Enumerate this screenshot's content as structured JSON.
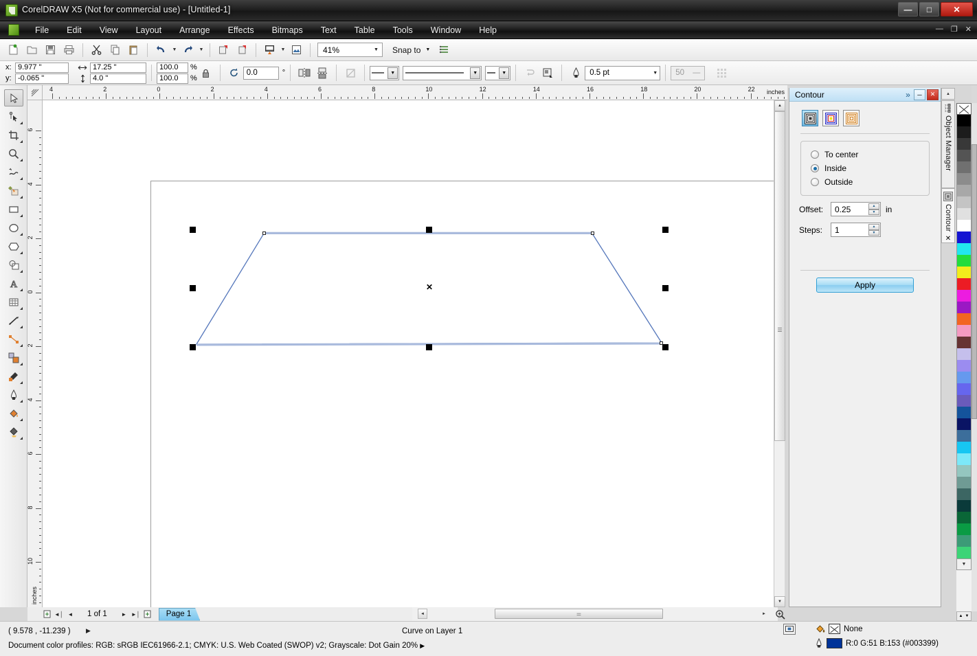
{
  "window": {
    "title": "CorelDRAW X5 (Not for commercial use) - [Untitled-1]",
    "app_icon": "coreldraw-icon",
    "buttons": {
      "minimize": "—",
      "maximize": "❐",
      "close": "✕"
    }
  },
  "menubar": {
    "doc_icon": "document-icon",
    "items": [
      {
        "label": "File",
        "mnemonic": "F"
      },
      {
        "label": "Edit",
        "mnemonic": "E"
      },
      {
        "label": "View",
        "mnemonic": "V"
      },
      {
        "label": "Layout",
        "mnemonic": "L"
      },
      {
        "label": "Arrange",
        "mnemonic": "A"
      },
      {
        "label": "Effects",
        "mnemonic": "c"
      },
      {
        "label": "Bitmaps",
        "mnemonic": "B"
      },
      {
        "label": "Text",
        "mnemonic": "x"
      },
      {
        "label": "Table",
        "mnemonic": "T"
      },
      {
        "label": "Tools",
        "mnemonic": "o"
      },
      {
        "label": "Window",
        "mnemonic": "W"
      },
      {
        "label": "Help",
        "mnemonic": "H"
      }
    ],
    "doc_buttons": {
      "minimize": "—",
      "restore": "❐",
      "close": "✕"
    }
  },
  "toolbar": {
    "buttons": [
      "new-icon",
      "open-icon",
      "save-icon",
      "print-icon",
      "cut-icon",
      "copy-icon",
      "paste-icon",
      "undo-icon",
      "redo-icon",
      "import-icon",
      "export-icon",
      "application-launcher-icon",
      "corel-connect-icon"
    ],
    "zoom_level": "41%",
    "snap_to_label": "Snap to",
    "options_icon": "options-icon"
  },
  "propertybar": {
    "x_label": "x:",
    "x_value": "9.977 \"",
    "y_label": "y:",
    "y_value": "-0.065 \"",
    "width_icon": "width-icon",
    "width_value": "17.25 \"",
    "height_icon": "height-icon",
    "height_value": "4.0 \"",
    "scale_h": "100.0",
    "scale_v": "100.0",
    "percent_symbol": "%",
    "lock_icon": "lock-ratio-icon",
    "rotate_icon": "rotation-icon",
    "rotation_value": "0.0",
    "degree_symbol": "°",
    "mirror_h_icon": "mirror-horizontal-icon",
    "mirror_v_icon": "mirror-vertical-icon",
    "to_curves_icon": "convert-to-curves-icon",
    "outline_arrow_label": "outline-arrow-selector",
    "outline_style_label": "outline-style-selector",
    "outline_end_arrow_label": "outline-end-arrow-selector",
    "wrap_text_icon": "wrap-paragraph-text-icon",
    "text_wrap_icon": "text-wrap-icon",
    "outline_pen_icon": "outline-width-icon",
    "outline_width": "0.5 pt",
    "bleed_value": "50",
    "bleed_icon": "bleed-limit-icon",
    "transparency_icon": "transparency-icon"
  },
  "toolbox": {
    "tools": [
      {
        "name": "pick-tool",
        "selected": true
      },
      {
        "name": "shape-tool",
        "selected": false
      },
      {
        "name": "crop-tool",
        "selected": false
      },
      {
        "name": "zoom-tool",
        "selected": false
      },
      {
        "name": "freehand-tool",
        "selected": false
      },
      {
        "name": "smart-fill-tool",
        "selected": false
      },
      {
        "name": "rectangle-tool",
        "selected": false
      },
      {
        "name": "ellipse-tool",
        "selected": false
      },
      {
        "name": "polygon-tool",
        "selected": false
      },
      {
        "name": "basic-shapes-tool",
        "selected": false
      },
      {
        "name": "text-tool",
        "selected": false
      },
      {
        "name": "table-tool",
        "selected": false
      },
      {
        "name": "dimension-tool",
        "selected": false
      },
      {
        "name": "connector-tool",
        "selected": false
      },
      {
        "name": "blend-tool",
        "selected": false
      },
      {
        "name": "transparency-tool",
        "selected": false
      },
      {
        "name": "color-eyedropper-tool",
        "selected": false
      },
      {
        "name": "outline-tool",
        "selected": false
      },
      {
        "name": "fill-tool",
        "selected": false
      },
      {
        "name": "interactive-fill-tool",
        "selected": false
      }
    ]
  },
  "rulers": {
    "unit_label": "inches",
    "h_ticks": [
      "4",
      "2",
      "0",
      "2",
      "4",
      "6",
      "8",
      "10",
      "12",
      "14",
      "16",
      "18",
      "20",
      "22"
    ],
    "v_ticks": [
      "6",
      "4",
      "2",
      "0",
      "2",
      "4",
      "6",
      "8",
      "10"
    ],
    "v_unit_label": "inches"
  },
  "canvas": {
    "selection_marker": "✕",
    "shape_name": "trapezoid-curve",
    "shape_outline_color": "#5577bb"
  },
  "pagebar": {
    "add_page_start_icon": "add-page-before-icon",
    "first_icon": "◀◀",
    "prev_icon": "◀",
    "page_counter": "1 of 1",
    "next_icon": "▶",
    "last_icon": "▶▶",
    "add_page_end_icon": "add-page-after-icon",
    "page_tab_label": "Page 1"
  },
  "statusbar": {
    "coordinates": "( 9.578 , -11.239 )",
    "expand_icon": "▶",
    "object_info": "Curve on Layer 1",
    "color_profiles": "Document color profiles: RGB: sRGB IEC61966-2.1; CMYK: U.S. Web Coated (SWOP) v2; Grayscale: Dot Gain 20%",
    "profiles_arrow": "▶",
    "fill_icon": "fill-bucket-icon",
    "fill_value": "None",
    "outline_icon": "outline-pen-icon",
    "outline_value": "R:0 G:51 B:153 (#003399)",
    "outline_color_hex": "#003399",
    "display_icon": "display-settings-icon"
  },
  "docker": {
    "title": "Contour",
    "expand_icon": "»",
    "minimize_icon": "—",
    "close_icon": "✕",
    "preset_buttons": [
      {
        "name": "contour-to-center-preset",
        "active": true
      },
      {
        "name": "contour-inside-preset",
        "active": false
      },
      {
        "name": "contour-outside-preset",
        "active": false
      }
    ],
    "direction_options": [
      {
        "label": "To center",
        "selected": false
      },
      {
        "label": "Inside",
        "selected": true
      },
      {
        "label": "Outside",
        "selected": false
      }
    ],
    "offset_label": "Offset:",
    "offset_value": "0.25",
    "offset_unit": "in",
    "steps_label": "Steps:",
    "steps_value": "1",
    "apply_label": "Apply",
    "side_tabs": [
      {
        "label": "Object Manager",
        "icon": "object-manager-icon"
      },
      {
        "label": "Contour",
        "icon": "contour-icon"
      }
    ],
    "side_close": "✕"
  },
  "palette": {
    "no_color_name": "no-color-swatch",
    "colors": [
      "#000000",
      "#1c1c1c",
      "#383838",
      "#545454",
      "#707070",
      "#8c8c8c",
      "#a8a8a8",
      "#c4c4c4",
      "#e0e0e0",
      "#ffffff",
      "#1414d2",
      "#22e6ee",
      "#22dd3c",
      "#f2ed1c",
      "#ec1c24",
      "#ec1ce0",
      "#9b18c4",
      "#f26522",
      "#f49ac1",
      "#663333",
      "#c5bfec",
      "#9b8cf0",
      "#6699ee",
      "#6666ee",
      "#6a5bbb",
      "#14539b",
      "#0a1464",
      "#3c6e9b",
      "#17c6f2",
      "#7ce8f8",
      "#94c6bf",
      "#6f9b94",
      "#3c6663",
      "#0a3a3a",
      "#0a6637",
      "#0a9b44",
      "#3c9b77",
      "#3cd477"
    ],
    "more_icon": "palette-more-icon",
    "scroll_up_icon": "▲",
    "scroll_down_icon": "▼"
  }
}
